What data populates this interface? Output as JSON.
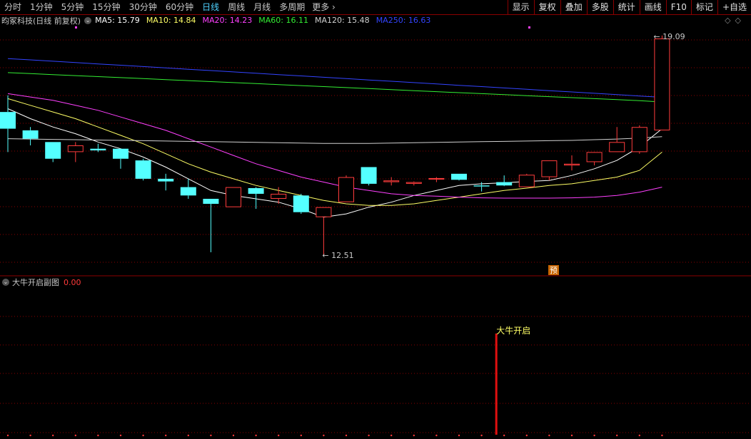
{
  "toolbar": {
    "periods": [
      {
        "label": "分时",
        "active": false
      },
      {
        "label": "1分钟",
        "active": false
      },
      {
        "label": "5分钟",
        "active": false
      },
      {
        "label": "15分钟",
        "active": false
      },
      {
        "label": "30分钟",
        "active": false
      },
      {
        "label": "60分钟",
        "active": false
      },
      {
        "label": "日线",
        "active": true
      },
      {
        "label": "周线",
        "active": false
      },
      {
        "label": "月线",
        "active": false
      },
      {
        "label": "多周期",
        "active": false
      }
    ],
    "more_label": "更多",
    "tools": [
      "显示",
      "复权",
      "叠加",
      "多股",
      "统计",
      "画线",
      "F10",
      "标记",
      "+自选"
    ]
  },
  "legend": {
    "stock": "昀冢科技(日线 前复权)",
    "ma": [
      {
        "label": "MA5: 15.79",
        "color": "#ffffff"
      },
      {
        "label": "MA10: 14.84",
        "color": "#ffff66"
      },
      {
        "label": "MA20: 14.23",
        "color": "#ff40ff"
      },
      {
        "label": "MA60: 16.11",
        "color": "#33ee33"
      },
      {
        "label": "MA120: 15.48",
        "color": "#d0d0d0"
      },
      {
        "label": "MA250: 16.63",
        "color": "#3344ff"
      }
    ]
  },
  "annotations": {
    "high": "19.09",
    "low": "12.51",
    "yu": "预",
    "signal": "大牛开启"
  },
  "sub": {
    "title": "大牛开启副图",
    "value": "0.00"
  },
  "colors": {
    "up": "#ff3c3c",
    "down": "#54ffff",
    "grid": "#8b0000"
  },
  "chart_data": {
    "type": "candlestick",
    "y_range": [
      12.3,
      19.3
    ],
    "candles": [
      {
        "o": 16.8,
        "h": 17.3,
        "l": 15.6,
        "c": 16.3
      },
      {
        "o": 16.25,
        "h": 16.35,
        "l": 15.8,
        "c": 16.0
      },
      {
        "o": 15.9,
        "h": 15.9,
        "l": 15.3,
        "c": 15.4
      },
      {
        "o": 15.6,
        "h": 15.9,
        "l": 15.3,
        "c": 15.8
      },
      {
        "o": 15.7,
        "h": 15.85,
        "l": 15.6,
        "c": 15.65
      },
      {
        "o": 15.7,
        "h": 15.7,
        "l": 15.1,
        "c": 15.4
      },
      {
        "o": 15.35,
        "h": 15.4,
        "l": 14.75,
        "c": 14.8
      },
      {
        "o": 14.8,
        "h": 14.95,
        "l": 14.45,
        "c": 14.72
      },
      {
        "o": 14.55,
        "h": 14.8,
        "l": 14.2,
        "c": 14.3
      },
      {
        "o": 14.2,
        "h": 14.2,
        "l": 12.6,
        "c": 14.05
      },
      {
        "o": 13.95,
        "h": 14.55,
        "l": 13.95,
        "c": 14.55
      },
      {
        "o": 14.52,
        "h": 14.55,
        "l": 13.9,
        "c": 14.35
      },
      {
        "o": 14.2,
        "h": 14.55,
        "l": 14.05,
        "c": 14.35
      },
      {
        "o": 14.3,
        "h": 14.35,
        "l": 13.75,
        "c": 13.8
      },
      {
        "o": 13.65,
        "h": 13.95,
        "l": 12.51,
        "c": 13.95
      },
      {
        "o": 14.1,
        "h": 14.9,
        "l": 14.1,
        "c": 14.85
      },
      {
        "o": 15.15,
        "h": 15.15,
        "l": 14.6,
        "c": 14.65
      },
      {
        "o": 14.7,
        "h": 14.85,
        "l": 14.6,
        "c": 14.75
      },
      {
        "o": 14.65,
        "h": 14.72,
        "l": 14.6,
        "c": 14.7
      },
      {
        "o": 14.8,
        "h": 14.85,
        "l": 14.7,
        "c": 14.82
      },
      {
        "o": 14.95,
        "h": 14.95,
        "l": 14.75,
        "c": 14.77
      },
      {
        "o": 14.6,
        "h": 14.7,
        "l": 14.42,
        "c": 14.57
      },
      {
        "o": 14.7,
        "h": 14.9,
        "l": 14.58,
        "c": 14.6
      },
      {
        "o": 14.55,
        "h": 14.95,
        "l": 14.55,
        "c": 14.92
      },
      {
        "o": 14.85,
        "h": 15.35,
        "l": 14.75,
        "c": 15.35
      },
      {
        "o": 15.2,
        "h": 15.5,
        "l": 15.05,
        "c": 15.25
      },
      {
        "o": 15.3,
        "h": 15.45,
        "l": 15.2,
        "c": 15.6
      },
      {
        "o": 15.6,
        "h": 16.35,
        "l": 15.6,
        "c": 15.9
      },
      {
        "o": 15.6,
        "h": 16.4,
        "l": 15.55,
        "c": 16.35
      },
      {
        "o": 16.25,
        "h": 19.09,
        "l": 16.25,
        "c": 19.0
      }
    ],
    "ma_lines": [
      {
        "name": "MA5",
        "color": "#ffffff",
        "values": [
          16.9,
          16.6,
          16.35,
          16.15,
          15.9,
          15.7,
          15.45,
          15.15,
          14.8,
          14.45,
          14.3,
          14.2,
          14.1,
          13.9,
          13.65,
          13.75,
          13.95,
          14.1,
          14.3,
          14.45,
          14.6,
          14.65,
          14.68,
          14.72,
          14.75,
          14.9,
          15.1,
          15.35,
          15.75,
          16.3
        ]
      },
      {
        "name": "MA10",
        "color": "#ffff66",
        "values": [
          17.2,
          17.0,
          16.8,
          16.6,
          16.35,
          16.1,
          15.85,
          15.55,
          15.25,
          15.0,
          14.8,
          14.6,
          14.45,
          14.3,
          14.15,
          14.05,
          14.0,
          14.0,
          14.05,
          14.15,
          14.25,
          14.35,
          14.45,
          14.52,
          14.6,
          14.65,
          14.75,
          14.85,
          15.05,
          15.6
        ]
      },
      {
        "name": "MA20",
        "color": "#ff40ff",
        "values": [
          17.35,
          17.25,
          17.15,
          17.0,
          16.85,
          16.65,
          16.45,
          16.25,
          16.0,
          15.75,
          15.5,
          15.25,
          15.05,
          14.85,
          14.7,
          14.55,
          14.45,
          14.35,
          14.3,
          14.28,
          14.25,
          14.23,
          14.22,
          14.22,
          14.22,
          14.23,
          14.25,
          14.3,
          14.4,
          14.55
        ]
      },
      {
        "name": "MA60",
        "color": "#33ee33",
        "values": [
          17.98,
          17.95,
          17.92,
          17.89,
          17.86,
          17.83,
          17.8,
          17.77,
          17.74,
          17.71,
          17.68,
          17.65,
          17.62,
          17.59,
          17.56,
          17.53,
          17.5,
          17.47,
          17.44,
          17.41,
          17.38,
          17.35,
          17.32,
          17.29,
          17.26,
          17.23,
          17.2,
          17.17,
          17.14,
          17.1
        ]
      },
      {
        "name": "MA120",
        "color": "#d0d0d0",
        "values": [
          16.0,
          15.99,
          15.98,
          15.97,
          15.96,
          15.95,
          15.94,
          15.93,
          15.92,
          15.91,
          15.9,
          15.89,
          15.88,
          15.87,
          15.86,
          15.86,
          15.86,
          15.87,
          15.88,
          15.89,
          15.9,
          15.91,
          15.92,
          15.93,
          15.94,
          15.95,
          15.97,
          15.99,
          16.02,
          16.06
        ]
      },
      {
        "name": "MA250",
        "color": "#3344ff",
        "values": [
          18.4,
          18.36,
          18.32,
          18.28,
          18.24,
          18.2,
          18.16,
          18.12,
          18.08,
          18.04,
          18.0,
          17.96,
          17.92,
          17.88,
          17.84,
          17.8,
          17.76,
          17.72,
          17.68,
          17.64,
          17.6,
          17.56,
          17.52,
          17.48,
          17.44,
          17.4,
          17.36,
          17.32,
          17.28,
          17.24
        ]
      }
    ],
    "sub_signal": {
      "index": 22,
      "value": 1
    }
  }
}
